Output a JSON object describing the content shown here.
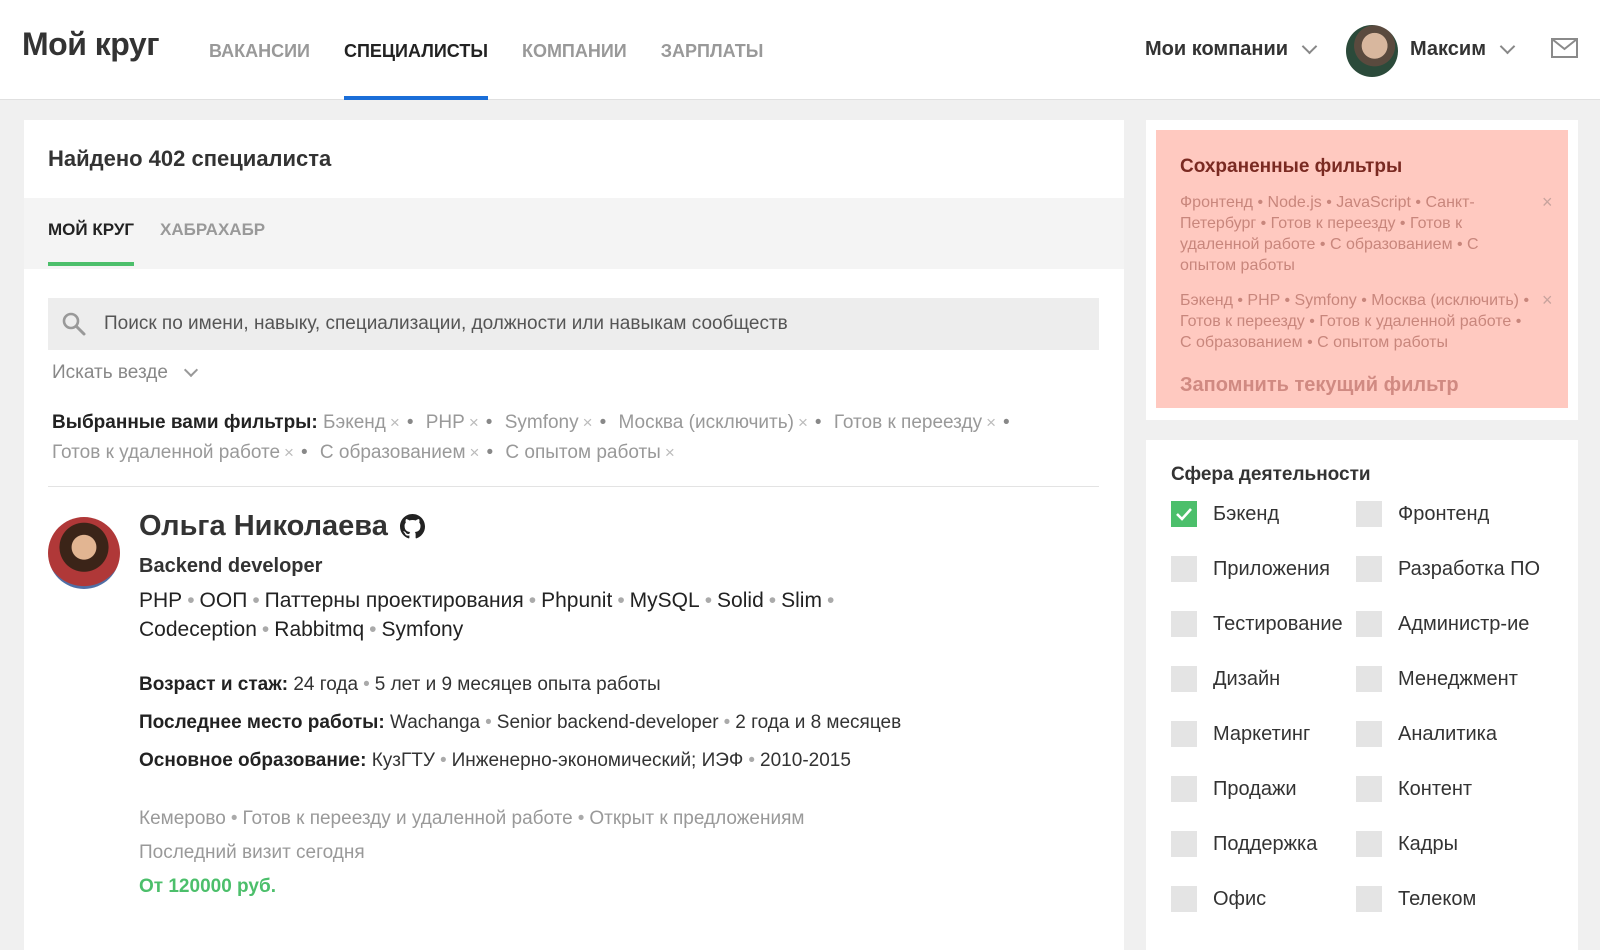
{
  "header": {
    "logo": "Мой круг",
    "nav": [
      {
        "label": "Вакансии",
        "active": false
      },
      {
        "label": "Специалисты",
        "active": true
      },
      {
        "label": "Компании",
        "active": false
      },
      {
        "label": "Зарплаты",
        "active": false
      }
    ],
    "my_companies": "Мои компании",
    "user_name": "Максим"
  },
  "main": {
    "found_text": "Найдено 402 специалиста",
    "tabs": [
      {
        "label": "Мой круг",
        "active": true
      },
      {
        "label": "Хабрахабр",
        "active": false
      }
    ],
    "search": {
      "placeholder": "Поиск по имени, навыку, специализации, должности или навыкам сообществ",
      "value": ""
    },
    "scope_label": "Искать везде",
    "filters_label": "Выбранные вами фильтры:",
    "filter_tags": [
      "Бэкенд",
      "PHP",
      "Symfony",
      "Москва (исключить)",
      "Готов к переезду",
      "Готов к удаленной работе",
      "С образованием",
      "С опытом работы"
    ],
    "remove_mark": "×",
    "candidate": {
      "name": "Ольга Николаева",
      "role": "Backend developer",
      "skills": [
        "PHP",
        "ООП",
        "Паттерны проектирования",
        "Phpunit",
        "MySQL",
        "Solid",
        "Slim",
        "Codeception",
        "Rabbitmq",
        "Symfony"
      ],
      "age_label": "Возраст и стаж:",
      "age_value": "24 года",
      "experience": "5 лет и 9 месяцев опыта работы",
      "last_job_label": "Последнее место работы:",
      "last_job_company": "Wachanga",
      "last_job_position": "Senior backend-developer",
      "last_job_duration": "2 года и 8 месяцев",
      "education_label": "Основное образование:",
      "education_school": "КузГТУ",
      "education_faculty": "Инженерно-экономический; ИЭФ",
      "education_years": "2010-2015",
      "city": "Кемерово",
      "relocation": "Готов к переезду и удаленной работе",
      "open_status": "Открыт к предложениям",
      "last_visit": "Последний визит сегодня",
      "salary": "От 120000 руб."
    }
  },
  "saved_filters": {
    "title": "Сохраненные фильтры",
    "items": [
      "Фронтенд • Node.js • JavaScript • Санкт-Петербург • Готов к переезду • Готов к удаленной работе • С образованием • С опытом работы",
      "Бэкенд • PHP • Symfony • Москва (исключить) • Готов к переезду • Готов к удаленной работе • С образованием • С опытом работы"
    ],
    "remove_mark": "×",
    "save_current": "Запомнить текущий фильтр"
  },
  "sphere": {
    "title": "Сфера деятельности",
    "items": [
      {
        "label": "Бэкенд",
        "checked": true
      },
      {
        "label": "Фронтенд",
        "checked": false
      },
      {
        "label": "Приложения",
        "checked": false
      },
      {
        "label": "Разработка ПО",
        "checked": false
      },
      {
        "label": "Тестирование",
        "checked": false
      },
      {
        "label": "Администр-ие",
        "checked": false
      },
      {
        "label": "Дизайн",
        "checked": false
      },
      {
        "label": "Менеджмент",
        "checked": false
      },
      {
        "label": "Маркетинг",
        "checked": false
      },
      {
        "label": "Аналитика",
        "checked": false
      },
      {
        "label": "Продажи",
        "checked": false
      },
      {
        "label": "Контент",
        "checked": false
      },
      {
        "label": "Поддержка",
        "checked": false
      },
      {
        "label": "Кадры",
        "checked": false
      },
      {
        "label": "Офис",
        "checked": false
      },
      {
        "label": "Телеком",
        "checked": false
      }
    ]
  },
  "colors": {
    "accent_blue": "#1a6ed8",
    "accent_green": "#4cbf6b",
    "saved_bg": "#ffc9c0",
    "saved_title": "#7a2a22"
  },
  "icons": [
    "chevron-down-icon",
    "mail-icon",
    "search-icon",
    "github-icon",
    "close-icon",
    "checkmark-icon"
  ]
}
